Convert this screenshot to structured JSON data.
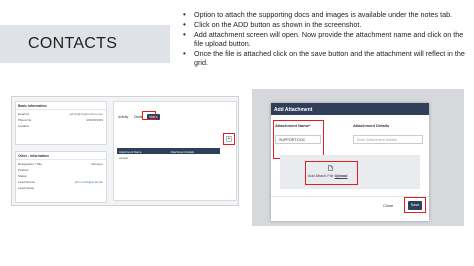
{
  "slide": {
    "title": "CONTACTS",
    "bullets": [
      "Option to attach the supporting docs and images is available under the notes tab.",
      "Click on the ADD button as shown in the screenshot.",
      "Add attachment screen will open. Now provide the attachment name and click on the file upload button.",
      "Once the file is attached click on the save button and the attachment will reflect in the grid."
    ]
  },
  "screenshot_left": {
    "basic_info": {
      "header": "Basic Information",
      "rows": [
        {
          "label": "Email Id",
          "value": "admin@mypremium.com"
        },
        {
          "label": "Phone No",
          "value": "9999999999"
        },
        {
          "label": "Location",
          "value": ""
        }
      ]
    },
    "other_info": {
      "header": "Other - Information",
      "rows": [
        {
          "label": "Designation / Title",
          "value": "Manager"
        },
        {
          "label": "Product",
          "value": ""
        },
        {
          "label": "Status",
          "value": ""
        },
        {
          "label": "Lead Source",
          "value": "john.smith@example"
        },
        {
          "label": "Lead Owner",
          "value": ""
        }
      ]
    },
    "tabs": [
      "Activity",
      "Deals",
      "Notes"
    ],
    "active_tab": "Notes",
    "add_button": "+",
    "grid": {
      "columns": [
        "Attachment Name",
        "Attachment Details"
      ],
      "rows": [
        [
          "sample",
          ""
        ]
      ]
    }
  },
  "screenshot_right": {
    "modal_title": "Add Attachment",
    "name_label": "Attachment Name*",
    "name_value": "SUPPORT DOC",
    "details_label": "Attachment Details",
    "details_placeholder": "Enter Attachment Details",
    "upload_icon": "file-icon",
    "upload_prefix": "Add Attach File",
    "upload_link": "Upload",
    "close_label": "Close",
    "save_label": "Save"
  },
  "colors": {
    "highlight": "#e02020",
    "navy": "#2f3f5a"
  }
}
